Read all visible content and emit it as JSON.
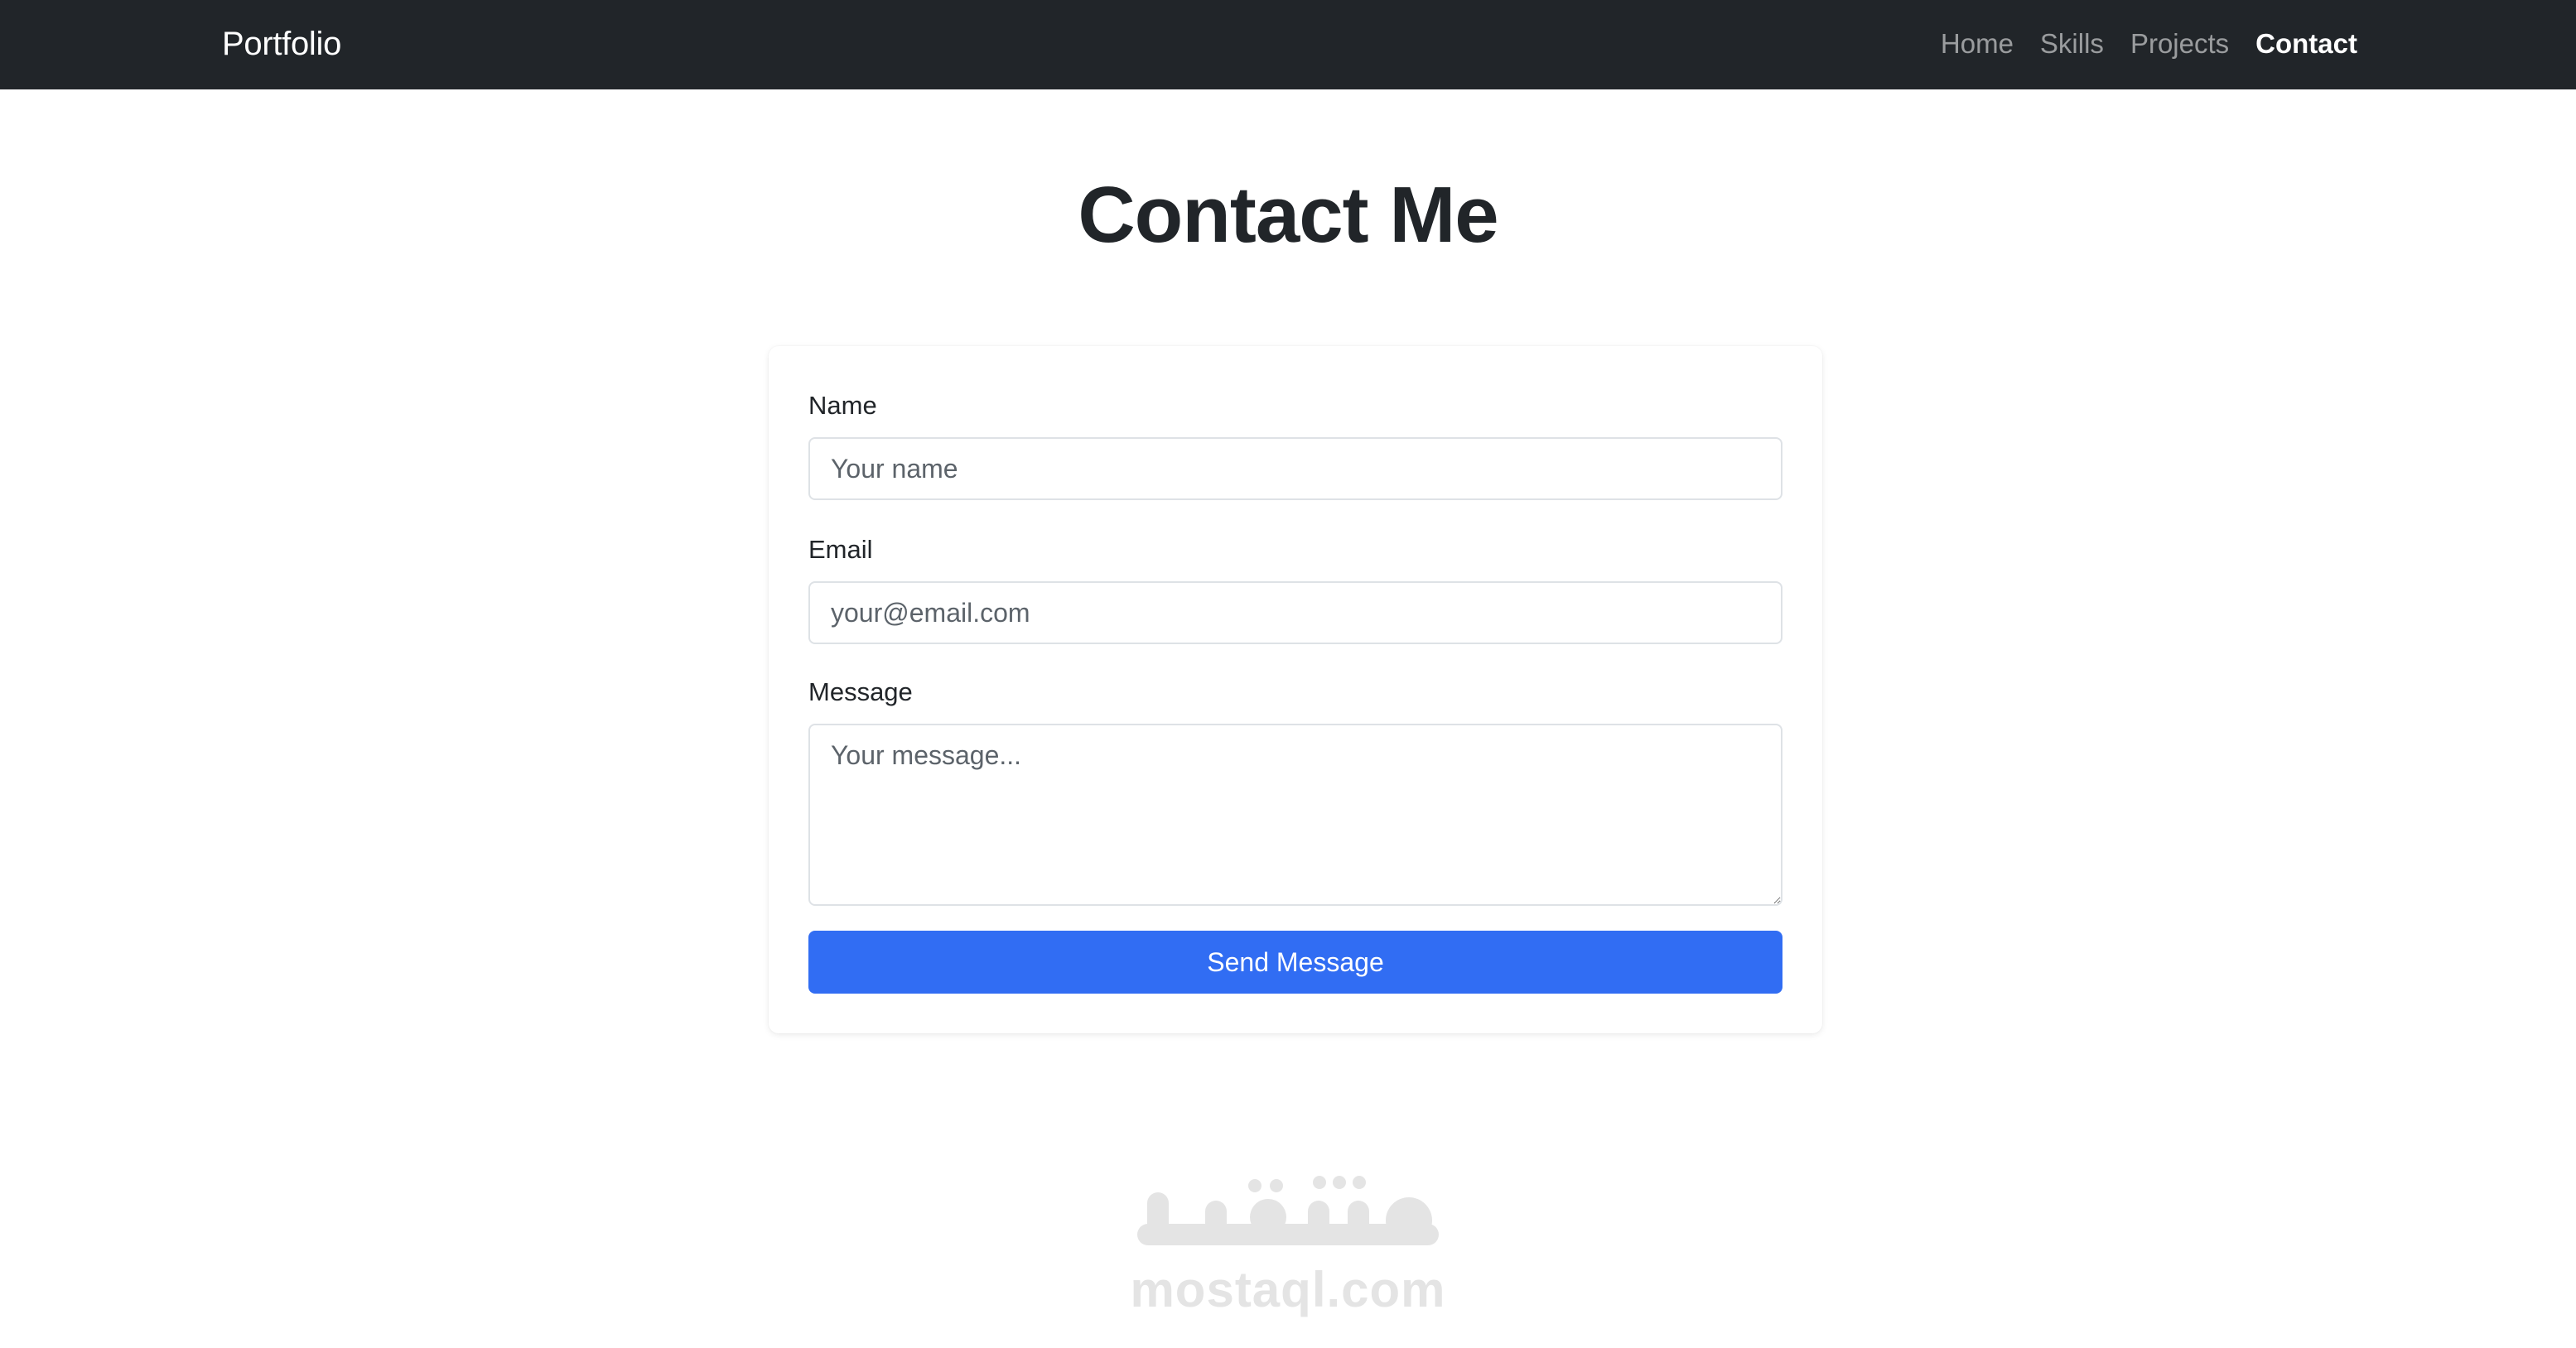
{
  "navbar": {
    "brand": "Portfolio",
    "links": [
      {
        "label": "Home",
        "active": false
      },
      {
        "label": "Skills",
        "active": false
      },
      {
        "label": "Projects",
        "active": false
      },
      {
        "label": "Contact",
        "active": true
      }
    ]
  },
  "main": {
    "title": "Contact Me"
  },
  "form": {
    "name_label": "Name",
    "name_placeholder": "Your name",
    "name_value": "",
    "email_label": "Email",
    "email_placeholder": "your@email.com",
    "email_value": "",
    "message_label": "Message",
    "message_placeholder": "Your message...",
    "message_value": "",
    "submit_label": "Send Message"
  },
  "watermark": {
    "logo_text": "مستقل",
    "site": "mostaql.com"
  },
  "colors": {
    "navbar_bg": "#212529",
    "primary_button": "#316df3",
    "page_bg": "#ffffff",
    "watermark": "#e4e4e4"
  },
  "icons": {
    "watermark_logo": "mostaql-logo"
  }
}
